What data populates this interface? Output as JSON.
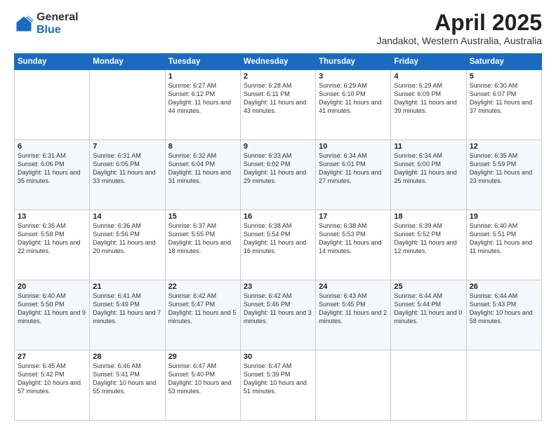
{
  "header": {
    "logo_general": "General",
    "logo_blue": "Blue",
    "title": "April 2025",
    "location": "Jandakot, Western Australia, Australia"
  },
  "weekdays": [
    "Sunday",
    "Monday",
    "Tuesday",
    "Wednesday",
    "Thursday",
    "Friday",
    "Saturday"
  ],
  "weeks": [
    [
      {
        "day": "",
        "sunrise": "",
        "sunset": "",
        "daylight": ""
      },
      {
        "day": "",
        "sunrise": "",
        "sunset": "",
        "daylight": ""
      },
      {
        "day": "1",
        "sunrise": "Sunrise: 6:27 AM",
        "sunset": "Sunset: 6:12 PM",
        "daylight": "Daylight: 11 hours and 44 minutes."
      },
      {
        "day": "2",
        "sunrise": "Sunrise: 6:28 AM",
        "sunset": "Sunset: 6:11 PM",
        "daylight": "Daylight: 11 hours and 43 minutes."
      },
      {
        "day": "3",
        "sunrise": "Sunrise: 6:29 AM",
        "sunset": "Sunset: 6:10 PM",
        "daylight": "Daylight: 11 hours and 41 minutes."
      },
      {
        "day": "4",
        "sunrise": "Sunrise: 6:29 AM",
        "sunset": "Sunset: 6:09 PM",
        "daylight": "Daylight: 11 hours and 39 minutes."
      },
      {
        "day": "5",
        "sunrise": "Sunrise: 6:30 AM",
        "sunset": "Sunset: 6:07 PM",
        "daylight": "Daylight: 11 hours and 37 minutes."
      }
    ],
    [
      {
        "day": "6",
        "sunrise": "Sunrise: 6:31 AM",
        "sunset": "Sunset: 6:06 PM",
        "daylight": "Daylight: 11 hours and 35 minutes."
      },
      {
        "day": "7",
        "sunrise": "Sunrise: 6:31 AM",
        "sunset": "Sunset: 6:05 PM",
        "daylight": "Daylight: 11 hours and 33 minutes."
      },
      {
        "day": "8",
        "sunrise": "Sunrise: 6:32 AM",
        "sunset": "Sunset: 6:04 PM",
        "daylight": "Daylight: 11 hours and 31 minutes."
      },
      {
        "day": "9",
        "sunrise": "Sunrise: 6:33 AM",
        "sunset": "Sunset: 6:02 PM",
        "daylight": "Daylight: 11 hours and 29 minutes."
      },
      {
        "day": "10",
        "sunrise": "Sunrise: 6:34 AM",
        "sunset": "Sunset: 6:01 PM",
        "daylight": "Daylight: 11 hours and 27 minutes."
      },
      {
        "day": "11",
        "sunrise": "Sunrise: 6:34 AM",
        "sunset": "Sunset: 6:00 PM",
        "daylight": "Daylight: 11 hours and 25 minutes."
      },
      {
        "day": "12",
        "sunrise": "Sunrise: 6:35 AM",
        "sunset": "Sunset: 5:59 PM",
        "daylight": "Daylight: 11 hours and 23 minutes."
      }
    ],
    [
      {
        "day": "13",
        "sunrise": "Sunrise: 6:36 AM",
        "sunset": "Sunset: 5:58 PM",
        "daylight": "Daylight: 11 hours and 22 minutes."
      },
      {
        "day": "14",
        "sunrise": "Sunrise: 6:36 AM",
        "sunset": "Sunset: 5:56 PM",
        "daylight": "Daylight: 11 hours and 20 minutes."
      },
      {
        "day": "15",
        "sunrise": "Sunrise: 6:37 AM",
        "sunset": "Sunset: 5:55 PM",
        "daylight": "Daylight: 11 hours and 18 minutes."
      },
      {
        "day": "16",
        "sunrise": "Sunrise: 6:38 AM",
        "sunset": "Sunset: 5:54 PM",
        "daylight": "Daylight: 11 hours and 16 minutes."
      },
      {
        "day": "17",
        "sunrise": "Sunrise: 6:38 AM",
        "sunset": "Sunset: 5:53 PM",
        "daylight": "Daylight: 11 hours and 14 minutes."
      },
      {
        "day": "18",
        "sunrise": "Sunrise: 6:39 AM",
        "sunset": "Sunset: 5:52 PM",
        "daylight": "Daylight: 11 hours and 12 minutes."
      },
      {
        "day": "19",
        "sunrise": "Sunrise: 6:40 AM",
        "sunset": "Sunset: 5:51 PM",
        "daylight": "Daylight: 11 hours and 11 minutes."
      }
    ],
    [
      {
        "day": "20",
        "sunrise": "Sunrise: 6:40 AM",
        "sunset": "Sunset: 5:50 PM",
        "daylight": "Daylight: 11 hours and 9 minutes."
      },
      {
        "day": "21",
        "sunrise": "Sunrise: 6:41 AM",
        "sunset": "Sunset: 5:49 PM",
        "daylight": "Daylight: 11 hours and 7 minutes."
      },
      {
        "day": "22",
        "sunrise": "Sunrise: 6:42 AM",
        "sunset": "Sunset: 5:47 PM",
        "daylight": "Daylight: 11 hours and 5 minutes."
      },
      {
        "day": "23",
        "sunrise": "Sunrise: 6:42 AM",
        "sunset": "Sunset: 5:46 PM",
        "daylight": "Daylight: 11 hours and 3 minutes."
      },
      {
        "day": "24",
        "sunrise": "Sunrise: 6:43 AM",
        "sunset": "Sunset: 5:45 PM",
        "daylight": "Daylight: 11 hours and 2 minutes."
      },
      {
        "day": "25",
        "sunrise": "Sunrise: 6:44 AM",
        "sunset": "Sunset: 5:44 PM",
        "daylight": "Daylight: 11 hours and 0 minutes."
      },
      {
        "day": "26",
        "sunrise": "Sunrise: 6:44 AM",
        "sunset": "Sunset: 5:43 PM",
        "daylight": "Daylight: 10 hours and 58 minutes."
      }
    ],
    [
      {
        "day": "27",
        "sunrise": "Sunrise: 6:45 AM",
        "sunset": "Sunset: 5:42 PM",
        "daylight": "Daylight: 10 hours and 57 minutes."
      },
      {
        "day": "28",
        "sunrise": "Sunrise: 6:46 AM",
        "sunset": "Sunset: 5:41 PM",
        "daylight": "Daylight: 10 hours and 55 minutes."
      },
      {
        "day": "29",
        "sunrise": "Sunrise: 6:47 AM",
        "sunset": "Sunset: 5:40 PM",
        "daylight": "Daylight: 10 hours and 53 minutes."
      },
      {
        "day": "30",
        "sunrise": "Sunrise: 6:47 AM",
        "sunset": "Sunset: 5:39 PM",
        "daylight": "Daylight: 10 hours and 51 minutes."
      },
      {
        "day": "",
        "sunrise": "",
        "sunset": "",
        "daylight": ""
      },
      {
        "day": "",
        "sunrise": "",
        "sunset": "",
        "daylight": ""
      },
      {
        "day": "",
        "sunrise": "",
        "sunset": "",
        "daylight": ""
      }
    ]
  ]
}
